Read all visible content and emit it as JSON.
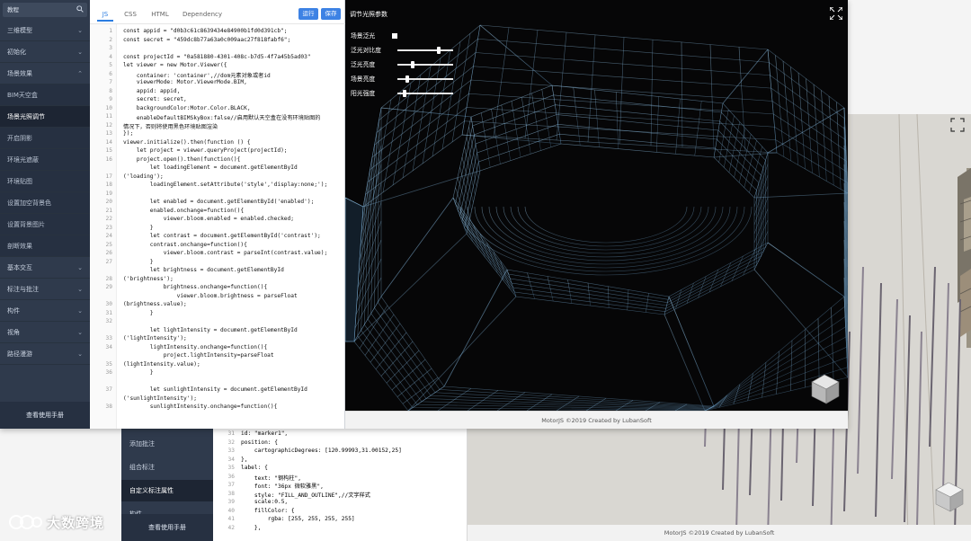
{
  "front": {
    "search": {
      "value": "教程"
    },
    "nav": [
      {
        "label": "三维模型",
        "chevron": true,
        "type": "top"
      },
      {
        "label": "初始化",
        "chevron": true,
        "type": "top"
      },
      {
        "label": "场景效果",
        "chevron": true,
        "type": "top",
        "open": true
      },
      {
        "label": "BIM天空盒",
        "type": "sub"
      },
      {
        "label": "场景光照调节",
        "type": "sub",
        "active": true
      },
      {
        "label": "开启阴影",
        "type": "sub"
      },
      {
        "label": "环境光遮蔽",
        "type": "sub"
      },
      {
        "label": "环境贴图",
        "type": "sub"
      },
      {
        "label": "设置加空背景色",
        "type": "sub"
      },
      {
        "label": "设置背景图片",
        "type": "sub"
      },
      {
        "label": "剖断效果",
        "type": "sub"
      },
      {
        "label": "基本交互",
        "chevron": true,
        "type": "top"
      },
      {
        "label": "标注与批注",
        "chevron": true,
        "type": "top"
      },
      {
        "label": "构件",
        "chevron": true,
        "type": "top"
      },
      {
        "label": "视角",
        "chevron": true,
        "type": "top"
      },
      {
        "label": "路径漫游",
        "chevron": true,
        "type": "top"
      }
    ],
    "help": "查看使用手册",
    "tabs": [
      "JS",
      "CSS",
      "HTML",
      "Dependency"
    ],
    "run_label": "运行",
    "save_label": "保存",
    "line_numbers": [
      "1",
      "2",
      "3",
      "4",
      "5",
      "6",
      "7",
      "8",
      "9",
      "10",
      "11",
      "12",
      "13",
      "14",
      "15",
      "16",
      "",
      "17",
      "18",
      "19",
      "20",
      "21",
      "22",
      "23",
      "24",
      "25",
      "26",
      "27",
      "",
      "28",
      "29",
      "",
      "30",
      "31",
      "32",
      "",
      "33",
      "34",
      "",
      "35",
      "36",
      "",
      "37",
      "",
      "38"
    ],
    "code_lines": [
      "const appid = \"d0b3c61c8639434e84900b1fd0d391cb\";",
      "const secret = \"459dc8b77a63a0c009aac27f818fabf6\";",
      "",
      "const projectId = \"0a581880-4301-408c-b7d5-4f7a45b5ad03\"",
      "let viewer = new Motor.Viewer({",
      "    container: 'container',//dom元素对象或者id",
      "    viewerMode: Motor.ViewerMode.BIM,",
      "    appid: appid,",
      "    secret: secret,",
      "    backgroundColor:Motor.Color.BLACK,",
      "    enableDefaultBIMSkyBox:false//启用默认天空盒在没有环境贴图的",
      "情况下，否则将使用黑色环境贴图渲染",
      "});",
      "viewer.initialize().then(function () {",
      "    let project = viewer.queryProject(projectId);",
      "    project.open().then(function(){",
      "        let loadingElement = document.getElementById",
      "('loading');",
      "        loadingElement.setAttribute('style','display:none;');",
      "",
      "        let enabled = document.getElementById('enabled');",
      "        enabled.onchange=function(){",
      "            viewer.bloom.enabled = enabled.checked;",
      "        }",
      "        let contrast = document.getElementById('contrast');",
      "        contrast.onchange=function(){",
      "            viewer.bloom.contrast = parseInt(contrast.value);",
      "        }",
      "        let brightness = document.getElementById",
      "('brightness');",
      "            brightness.onchange=function(){",
      "                viewer.bloom.brightness = parseFloat",
      "(brightness.value);",
      "        }",
      "",
      "        let lightIntensity = document.getElementById",
      "('lightIntensity');",
      "        lightIntensity.onchange=function(){",
      "            project.lightIntensity=parseFloat",
      "(lightIntensity.value);",
      "        }",
      "",
      "        let sunlightIntensity = document.getElementById",
      "('sunlightIntensity');",
      "        sunlightIntensity.onchange=function(){"
    ],
    "panel": {
      "title": "调节光照参数",
      "controls": [
        {
          "label": "场景泛光",
          "kind": "checkbox",
          "checked": true
        },
        {
          "label": "泛光对比度",
          "kind": "slider",
          "value": 0.75
        },
        {
          "label": "泛光亮度",
          "kind": "slider",
          "value": 0.25
        },
        {
          "label": "场景亮度",
          "kind": "slider",
          "value": 0.15
        },
        {
          "label": "阳光强度",
          "kind": "slider",
          "value": 0.1
        }
      ]
    },
    "footer": "MotorJS ©2019 Created by LubanSoft"
  },
  "back": {
    "nav": [
      {
        "label": "添加批注"
      },
      {
        "label": "组合标注"
      },
      {
        "label": "自定义标注属性",
        "active": true
      },
      {
        "label": "构件",
        "chevron": true
      }
    ],
    "help": "查看使用手册",
    "line_numbers": [
      "31",
      "32",
      "33",
      "34",
      "35",
      "36",
      "37",
      "38",
      "39",
      "40",
      "41",
      "42"
    ],
    "code_lines": [
      "id: \"marker1\",",
      "position: {",
      "    cartographicDegrees: [120.99993,31.00152,25]",
      "},",
      "label: {",
      "    text: \"钢构柱\",",
      "    font: \"36px 微软雅黑\",",
      "    style: \"FILL_AND_OUTLINE\",//文字样式",
      "    scale:0.5,",
      "    fillColor: {",
      "        rgba: [255, 255, 255, 255]",
      "    },"
    ],
    "footer": "MotorJS ©2019 Created by LubanSoft"
  },
  "watermark": "大数跨境",
  "colors": {
    "sidebar": "#2f3a4c",
    "accent": "#2b7de1",
    "viewport": "#060607",
    "wireframe": "#7fb6e0"
  }
}
